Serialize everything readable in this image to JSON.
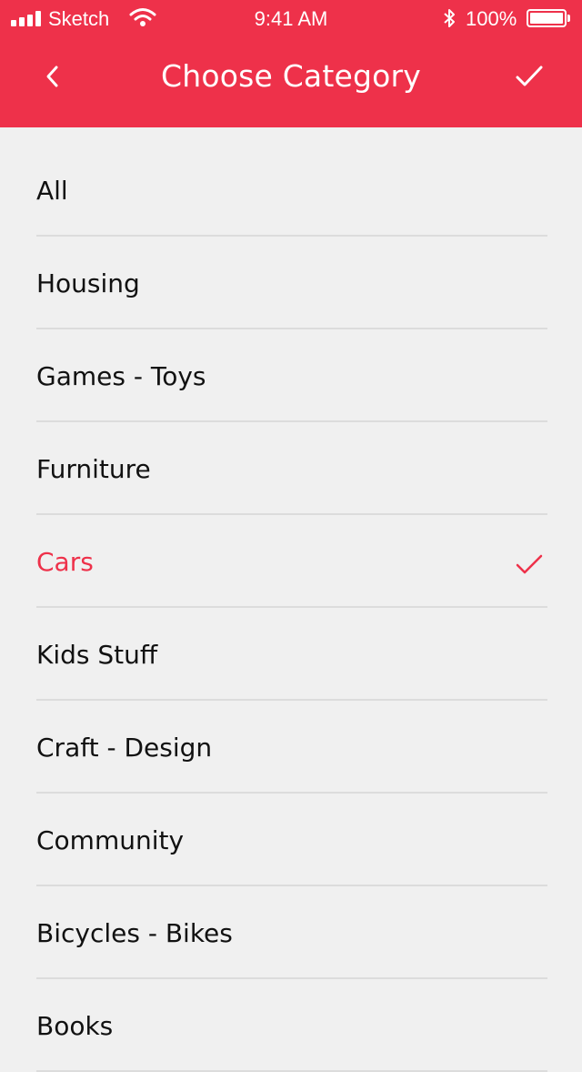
{
  "status_bar": {
    "carrier": "Sketch",
    "time": "9:41 AM",
    "battery": "100%"
  },
  "nav": {
    "title": "Choose Category",
    "back_icon": "chevron-left-icon",
    "done_icon": "checkmark-icon"
  },
  "colors": {
    "accent": "#ee314a",
    "background": "#f0f0f0",
    "text": "#111111",
    "divider": "#dcdcdc"
  },
  "categories": [
    {
      "label": "All",
      "selected": false
    },
    {
      "label": "Housing",
      "selected": false
    },
    {
      "label": "Games - Toys",
      "selected": false
    },
    {
      "label": "Furniture",
      "selected": false
    },
    {
      "label": "Cars",
      "selected": true
    },
    {
      "label": "Kids Stuff",
      "selected": false
    },
    {
      "label": "Craft - Design",
      "selected": false
    },
    {
      "label": "Community",
      "selected": false
    },
    {
      "label": "Bicycles - Bikes",
      "selected": false
    },
    {
      "label": "Books",
      "selected": false
    }
  ]
}
